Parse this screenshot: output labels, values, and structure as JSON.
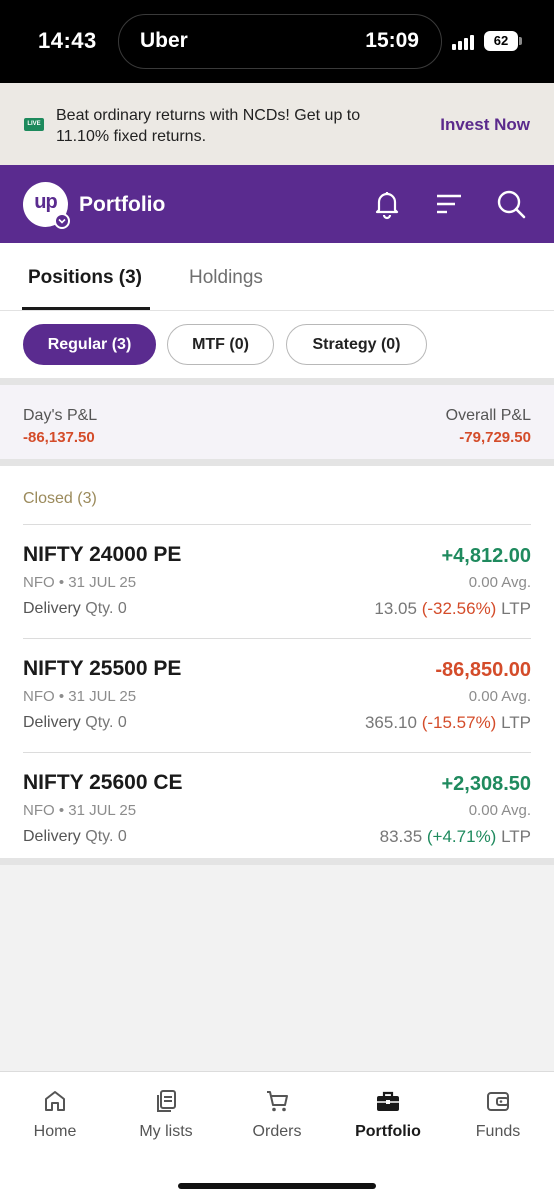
{
  "status_bar": {
    "time": "14:43",
    "live_activity_app": "Uber",
    "live_activity_time": "15:09",
    "battery": "62"
  },
  "promo": {
    "badge": "LIVE",
    "text": "Beat ordinary returns with NCDs! Get up to 11.10% fixed returns.",
    "cta": "Invest Now"
  },
  "header": {
    "logo_text": "up",
    "title": "Portfolio",
    "icons": [
      "bell-icon",
      "filter-icon",
      "search-icon"
    ]
  },
  "tabs": [
    {
      "label": "Positions (3)",
      "active": true
    },
    {
      "label": "Holdings",
      "active": false
    }
  ],
  "chips": [
    {
      "label": "Regular (3)",
      "active": true
    },
    {
      "label": "MTF (0)",
      "active": false
    },
    {
      "label": "Strategy (0)",
      "active": false
    }
  ],
  "summary": {
    "day_label": "Day's P&L",
    "day_value": "-86,137.50",
    "overall_label": "Overall P&L",
    "overall_value": "-79,729.50"
  },
  "positions": {
    "section_label": "Closed (3)",
    "items": [
      {
        "name": "NIFTY 24000 PE",
        "pnl": "+4,812.00",
        "pnl_color": "#1f8a5e",
        "exchange": "NFO • 31 JUL 25",
        "avg": "0.00 Avg.",
        "product": "Delivery",
        "qty": "Qty. 0",
        "ltp": "13.05",
        "change": "(-32.56%)",
        "change_color": "#d44c2a",
        "ltp_suffix": "LTP"
      },
      {
        "name": "NIFTY 25500 PE",
        "pnl": "-86,850.00",
        "pnl_color": "#d44c2a",
        "exchange": "NFO • 31 JUL 25",
        "avg": "0.00 Avg.",
        "product": "Delivery",
        "qty": "Qty. 0",
        "ltp": "365.10",
        "change": "(-15.57%)",
        "change_color": "#d44c2a",
        "ltp_suffix": "LTP"
      },
      {
        "name": "NIFTY 25600 CE",
        "pnl": "+2,308.50",
        "pnl_color": "#1f8a5e",
        "exchange": "NFO • 31 JUL 25",
        "avg": "0.00 Avg.",
        "product": "Delivery",
        "qty": "Qty. 0",
        "ltp": "83.35",
        "change": "(+4.71%)",
        "change_color": "#1f8a5e",
        "ltp_suffix": "LTP"
      }
    ]
  },
  "bottom_nav": [
    {
      "label": "Home",
      "icon": "home-icon",
      "active": false
    },
    {
      "label": "My lists",
      "icon": "lists-icon",
      "active": false
    },
    {
      "label": "Orders",
      "icon": "cart-icon",
      "active": false
    },
    {
      "label": "Portfolio",
      "icon": "briefcase-icon",
      "active": true
    },
    {
      "label": "Funds",
      "icon": "wallet-icon",
      "active": false
    }
  ],
  "colors": {
    "brand": "#5a2b8f",
    "profit": "#1f8a5e",
    "loss": "#d44c2a"
  }
}
